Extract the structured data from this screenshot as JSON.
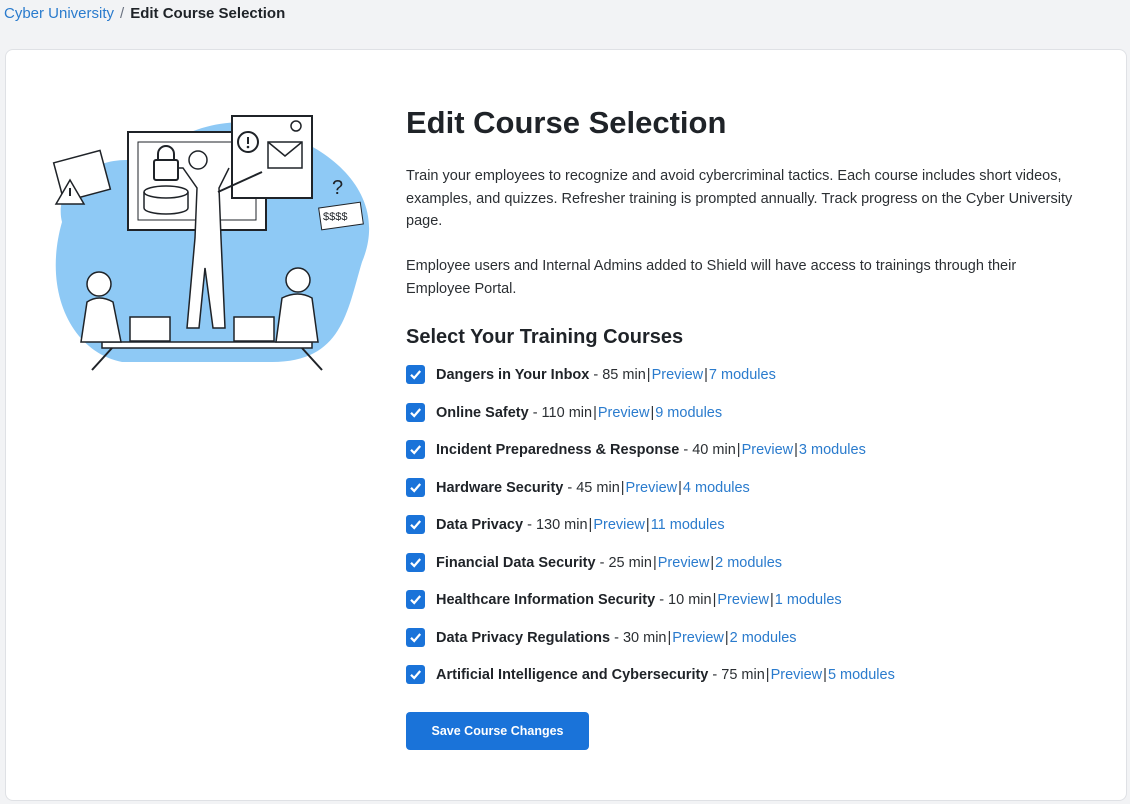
{
  "breadcrumb": {
    "root": "Cyber University",
    "separator": "/",
    "current": "Edit Course Selection"
  },
  "page": {
    "title": "Edit Course Selection",
    "description_1": "Train your employees to recognize and avoid cybercriminal tactics. Each course includes short videos, examples, and quizzes. Refresher training is prompted annually. Track progress on the Cyber University page.",
    "description_2": "Employee users and Internal Admins added to Shield will have access to trainings through their Employee Portal.",
    "section_title": "Select Your Training Courses",
    "save_label": "Save Course Changes"
  },
  "courses": [
    {
      "name": "Dangers in Your Inbox",
      "duration": "- 85 min",
      "preview": "Preview",
      "modules": "7 modules",
      "checked": true
    },
    {
      "name": "Online Safety",
      "duration": "- 110 min",
      "preview": "Preview",
      "modules": "9 modules",
      "checked": true
    },
    {
      "name": "Incident Preparedness & Response",
      "duration": "- 40 min",
      "preview": "Preview",
      "modules": "3 modules",
      "checked": true
    },
    {
      "name": "Hardware Security",
      "duration": "- 45 min",
      "preview": "Preview",
      "modules": "4 modules",
      "checked": true
    },
    {
      "name": "Data Privacy",
      "duration": "- 130 min",
      "preview": "Preview",
      "modules": "11 modules",
      "checked": true
    },
    {
      "name": "Financial Data Security",
      "duration": "- 25 min",
      "preview": "Preview",
      "modules": "2 modules",
      "checked": true
    },
    {
      "name": "Healthcare Information Security",
      "duration": "- 10 min",
      "preview": "Preview",
      "modules": "1 modules",
      "checked": true
    },
    {
      "name": "Data Privacy Regulations",
      "duration": "- 30 min",
      "preview": "Preview",
      "modules": "2 modules",
      "checked": true
    },
    {
      "name": "Artificial Intelligence and Cybersecurity",
      "duration": "- 75 min",
      "preview": "Preview",
      "modules": "5 modules",
      "checked": true
    }
  ],
  "illustration": {
    "dollar_text": "$$$$",
    "icon": "cybersecurity-training-illustration"
  },
  "colors": {
    "accent": "#1a73d9",
    "link": "#2a7bcd",
    "illustration_blob": "#8ec9f5"
  }
}
